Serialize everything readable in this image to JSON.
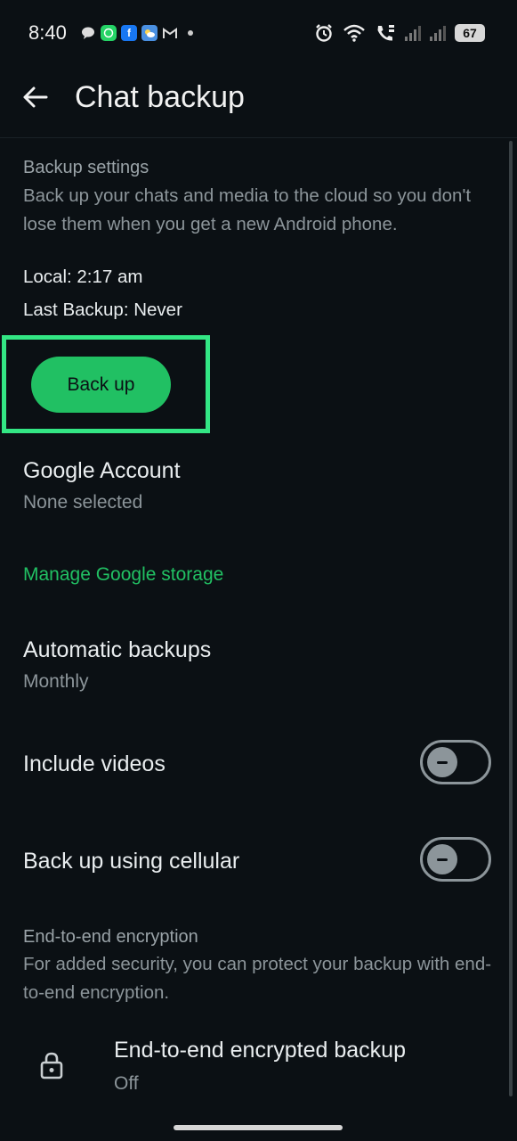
{
  "status_bar": {
    "time": "8:40",
    "battery": "67",
    "notification_icons": [
      "chat-bubble-icon",
      "whatsapp-icon",
      "facebook-icon",
      "weather-icon",
      "gmail-icon",
      "dot-icon"
    ],
    "status_icons": [
      "alarm-icon",
      "wifi-icon",
      "call-icon",
      "signal-icon",
      "signal-icon",
      "battery-icon"
    ]
  },
  "header": {
    "title": "Chat backup"
  },
  "backup_settings": {
    "title": "Backup settings",
    "description": "Back up your chats and media to the cloud so you don't lose them when you get a new Android phone.",
    "local": "Local: 2:17 am",
    "last_backup": "Last Backup: Never",
    "button_label": "Back up"
  },
  "google_account": {
    "title": "Google Account",
    "value": "None selected"
  },
  "manage_storage_label": "Manage Google storage",
  "automatic_backups": {
    "title": "Automatic backups",
    "value": "Monthly"
  },
  "include_videos": {
    "label": "Include videos",
    "enabled": false
  },
  "cellular": {
    "label": "Back up using cellular",
    "enabled": false
  },
  "encryption": {
    "title": "End-to-end encryption",
    "description": "For added security, you can protect your backup with end-to-end encryption.",
    "item_title": "End-to-end encrypted backup",
    "item_value": "Off"
  },
  "colors": {
    "background": "#0b1014",
    "accent": "#21c063",
    "highlight": "#33e684"
  }
}
